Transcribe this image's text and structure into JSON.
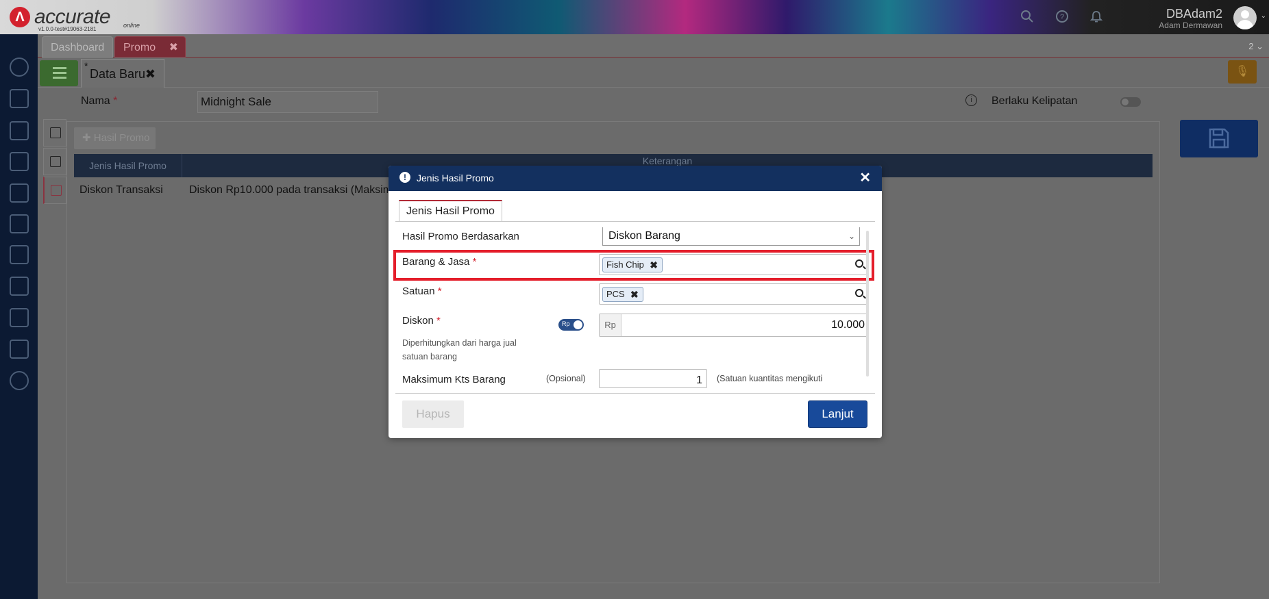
{
  "app": {
    "logo_text": "accurate",
    "logo_sub": "online",
    "version": "v1.0.0-test#19063-2181",
    "user_name": "DBAdam2",
    "user_sub": "Adam Dermawan"
  },
  "tabs": [
    {
      "label": "Dashboard"
    },
    {
      "label": "Promo"
    }
  ],
  "tab_count": "2",
  "subtab": {
    "star": "*",
    "label": "Data Baru"
  },
  "form": {
    "nama_label": "Nama",
    "nama_value": "Midnight Sale",
    "kelipatan_label": "Berlaku Kelipatan",
    "required_mark": "*"
  },
  "grid": {
    "add_button": "Hasil Promo",
    "columns": [
      "Jenis Hasil Promo",
      "Keterangan"
    ],
    "rows": [
      {
        "jenis": "Diskon Transaksi",
        "keterangan": "Diskon Rp10.000 pada transaksi (Maksim"
      }
    ]
  },
  "modal": {
    "title": "Jenis Hasil Promo",
    "tab_label": "Jenis Hasil Promo",
    "fields": {
      "berdasarkan_label": "Hasil Promo Berdasarkan",
      "berdasarkan_value": "Diskon Barang",
      "barang_label": "Barang & Jasa",
      "barang_tag": "Fish Chip",
      "satuan_label": "Satuan",
      "satuan_tag": "PCS",
      "diskon_label": "Diskon",
      "diskon_toggle": "Rp",
      "diskon_note": "Diperhitungkan dari harga jual satuan barang",
      "diskon_prefix": "Rp",
      "diskon_value": "10.000",
      "maks_label": "Maksimum Kts Barang",
      "maks_optional": "(Opsional)",
      "maks_value": "1",
      "maks_note": "(Satuan kuantitas mengikuti"
    },
    "buttons": {
      "hapus": "Hapus",
      "lanjut": "Lanjut"
    }
  },
  "colors": {
    "sidebar": "#0c1a33",
    "modal_header": "#13305f",
    "primary_button": "#184a9a",
    "highlight": "#e41e2b",
    "required": "#d3212d"
  }
}
